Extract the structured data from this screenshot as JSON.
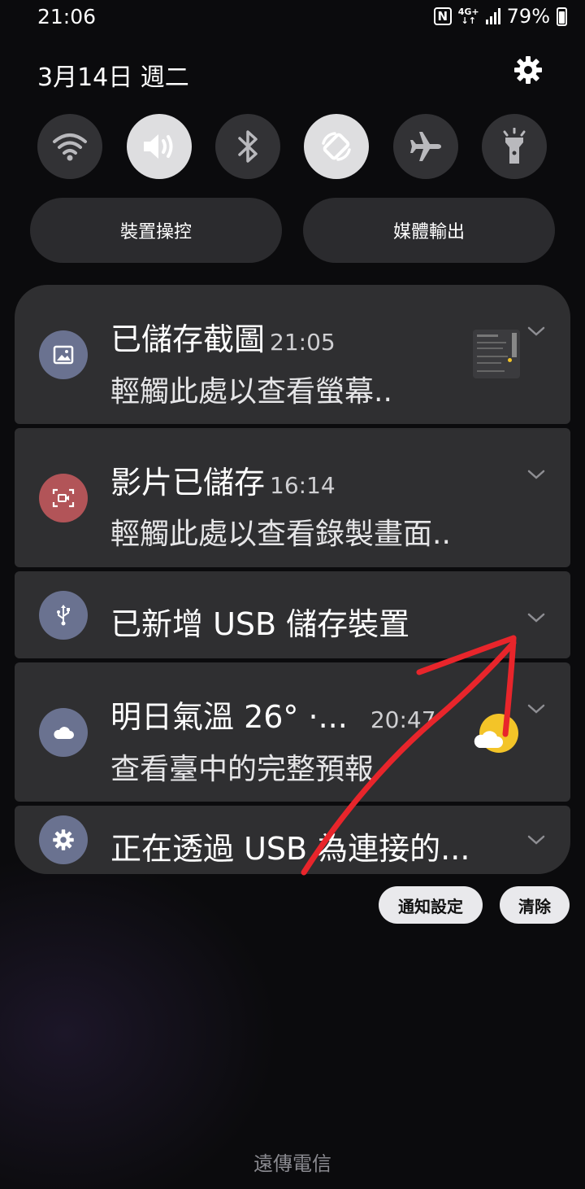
{
  "status_bar": {
    "time": "21:06",
    "nfc_label": "N",
    "network_label": "4G+",
    "battery": "79%"
  },
  "header": {
    "date": "3月14日 週二"
  },
  "quick_settings": {
    "toggles": [
      {
        "name": "wifi-icon",
        "state": "off"
      },
      {
        "name": "sound-icon",
        "state": "on"
      },
      {
        "name": "bluetooth-icon",
        "state": "off"
      },
      {
        "name": "auto-rotate-icon",
        "state": "on"
      },
      {
        "name": "airplane-mode-icon",
        "state": "off"
      },
      {
        "name": "flashlight-icon",
        "state": "off"
      }
    ],
    "device_control_label": "裝置操控",
    "media_output_label": "媒體輸出"
  },
  "notifications": [
    {
      "title": "已儲存截圖",
      "time": "21:05",
      "body": "輕觸此處以查看螢幕..",
      "icon": "image-icon",
      "icon_color": "#6a7290"
    },
    {
      "title": "影片已儲存",
      "time": "16:14",
      "body": "輕觸此處以查看錄製畫面..",
      "icon": "screen-record-icon",
      "icon_color": "#b25458"
    },
    {
      "title": "已新增 USB 儲存裝置",
      "icon": "usb-icon",
      "icon_color": "#6a7290"
    },
    {
      "title": "明日氣溫 26° ·...",
      "time": "20:47",
      "body": "查看臺中的完整預報",
      "icon": "cloud-icon",
      "icon_color": "#6a7290"
    },
    {
      "title": "正在透過 USB 為連接的...",
      "icon": "settings-icon",
      "icon_color": "#6a7290"
    }
  ],
  "actions": {
    "notification_settings": "通知設定",
    "clear": "清除"
  },
  "footer": {
    "carrier": "遠傳電信"
  },
  "colors": {
    "background": "#0b0b0d",
    "card": "#2f2f31",
    "toggle_on": "#dedee0",
    "toggle_off": "#323235",
    "annotation_arrow": "#e8252b",
    "weather_sun": "#f3c428"
  }
}
